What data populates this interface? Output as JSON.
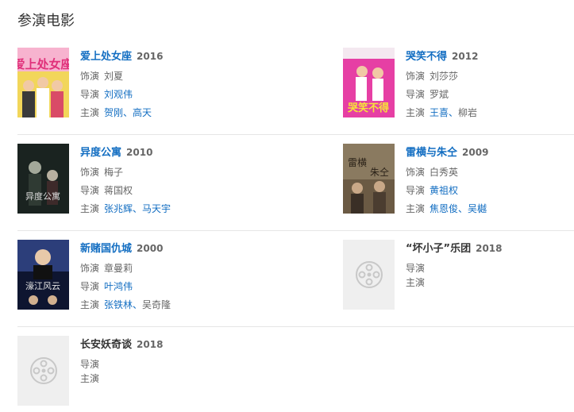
{
  "section": {
    "title": "参演电影"
  },
  "labels": {
    "role": "饰演",
    "director": "导演",
    "starring": "主演"
  },
  "films": [
    {
      "title": "爱上处女座",
      "year": "2016",
      "role": "刘夏",
      "director": "刘观伟",
      "stars": [
        "贺刚",
        "高天"
      ],
      "poster": "poster-aishang"
    },
    {
      "title": "哭笑不得",
      "year": "2012",
      "role": "刘莎莎",
      "director": "罗斌",
      "stars": [
        "王喜",
        "柳岩"
      ],
      "poster": "poster-kuxiao"
    },
    {
      "title": "异度公寓",
      "year": "2010",
      "role": "梅子",
      "director": "蒋国权",
      "stars": [
        "张兆辉",
        "马天宇"
      ],
      "poster": "poster-yidu"
    },
    {
      "title": "雷横与朱仝",
      "year": "2009",
      "role": "白秀英",
      "director": "黄祖权",
      "stars": [
        "焦恩俊",
        "吴樾"
      ],
      "poster": "poster-leiheng"
    },
    {
      "title": "新赌国仇城",
      "year": "2000",
      "role": "章曼莉",
      "director": "叶鸿伟",
      "stars": [
        "张铁林",
        "吴奇隆"
      ],
      "poster": "poster-xindu"
    },
    {
      "title": "“坏小子”乐团",
      "year": "2018",
      "poster": "film-reel-icon"
    },
    {
      "title": "长安妖奇谈",
      "year": "2018",
      "poster": "film-reel-icon"
    }
  ]
}
